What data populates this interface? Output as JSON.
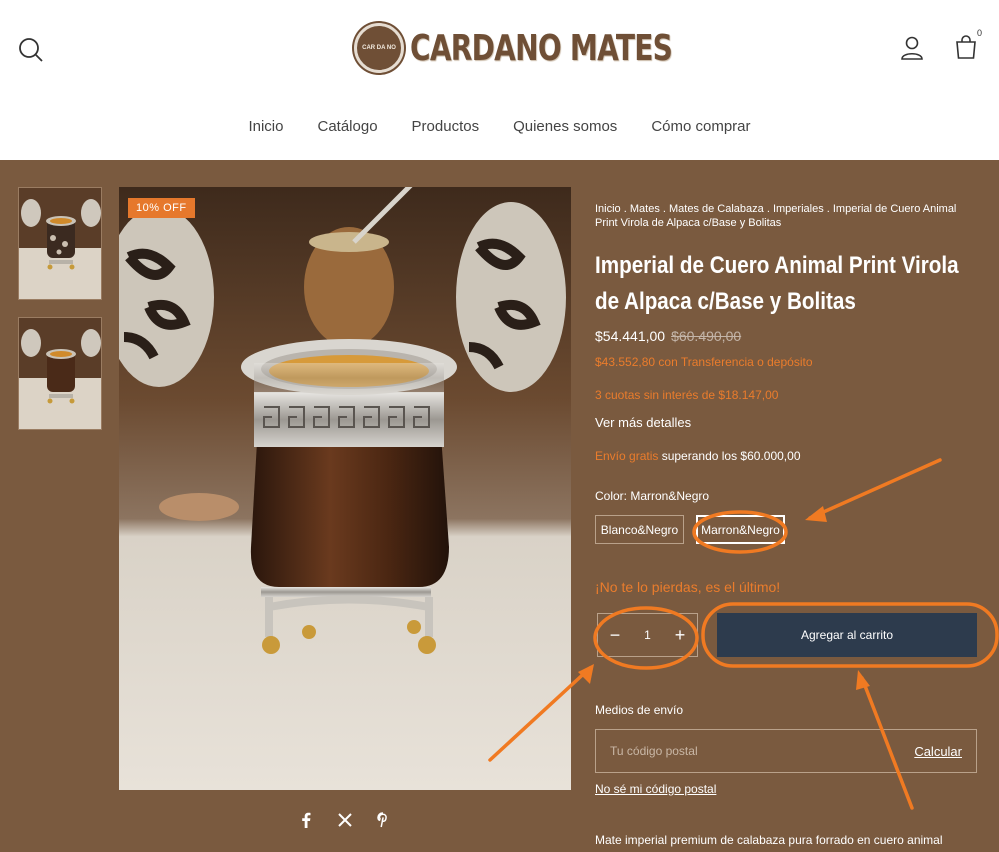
{
  "brand": {
    "name": "CARDANO MATES",
    "badge_text": "CAR DA NO"
  },
  "header": {
    "cart_count": "0"
  },
  "nav": [
    "Inicio",
    "Catálogo",
    "Productos",
    "Quienes somos",
    "Cómo comprar"
  ],
  "gallery": {
    "discount_badge": "10% OFF"
  },
  "breadcrumb": [
    "Inicio",
    "Mates",
    "Mates de Calabaza",
    "Imperiales",
    "Imperial de Cuero Animal Print Virola de Alpaca c/Base y Bolitas"
  ],
  "product": {
    "title": "Imperial de Cuero Animal Print Virola de Alpaca c/Base y Bolitas",
    "price": "$54.441,00",
    "price_old": "$60.490,00",
    "transfer_price": "$43.552,80 con Transferencia o depósito",
    "installments": "3 cuotas sin interés de $18.147,00",
    "more_details": "Ver más detalles",
    "shipping_free": "Envío gratis",
    "shipping_text": " superando los $60.000,00",
    "color_label": "Color: Marron&Negro",
    "variants": [
      "Blanco&Negro",
      "Marron&Negro"
    ],
    "stock_msg": "¡No te lo pierdas, es el último!",
    "quantity": "1",
    "add_to_cart": "Agregar al carrito",
    "shipping_methods": "Medios de envío",
    "postal_placeholder": "Tu código postal",
    "calc": "Calcular",
    "no_postal": "No sé mi código postal",
    "description": "Mate imperial premium de calabaza pura forrado en cuero animal"
  },
  "colors": {
    "brown": "#7a5a3f",
    "accent": "#ea7c2c",
    "cart_button": "#2d3b4d",
    "annotation": "#f07a22"
  },
  "icons": [
    "search-icon",
    "user-icon",
    "cart-icon",
    "facebook-icon",
    "x-icon",
    "pinterest-icon"
  ]
}
